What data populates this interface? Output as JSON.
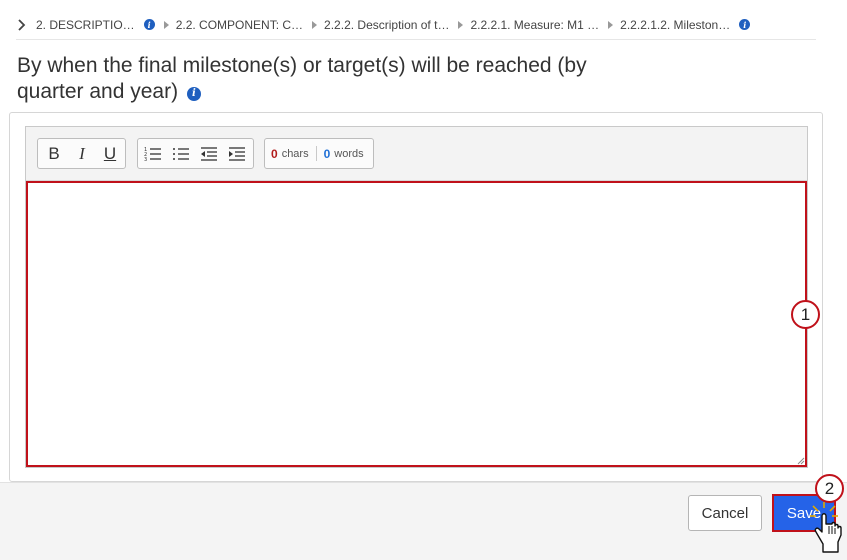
{
  "breadcrumb": {
    "items": [
      {
        "label": "2. DESCRIPTIO…",
        "info": true
      },
      {
        "label": "2.2. COMPONENT: C…",
        "info": false
      },
      {
        "label": "2.2.2. Description of t…",
        "info": false
      },
      {
        "label": "2.2.2.1. Measure: M1 …",
        "info": false
      },
      {
        "label": "2.2.2.1.2. Mileston…",
        "info": true
      }
    ]
  },
  "title": {
    "line1": "By when the final milestone(s) or target(s) will be reached (by",
    "line2": "quarter and year)"
  },
  "toolbar": {
    "bold": "B",
    "italic": "I",
    "underline": "U",
    "chars_count": "0",
    "chars_label": "chars",
    "words_count": "0",
    "words_label": "words"
  },
  "editor": {
    "value": ""
  },
  "callouts": {
    "one": "1",
    "two": "2"
  },
  "footer": {
    "cancel_label": "Cancel",
    "save_label": "Save"
  },
  "colors": {
    "accent": "#2563e8",
    "highlight": "#c0111a",
    "info": "#1f5fbf"
  },
  "icons": [
    "chevron-right-icon",
    "info-icon",
    "ordered-list-icon",
    "bullet-list-icon",
    "outdent-icon",
    "indent-icon",
    "hand-cursor-icon"
  ]
}
